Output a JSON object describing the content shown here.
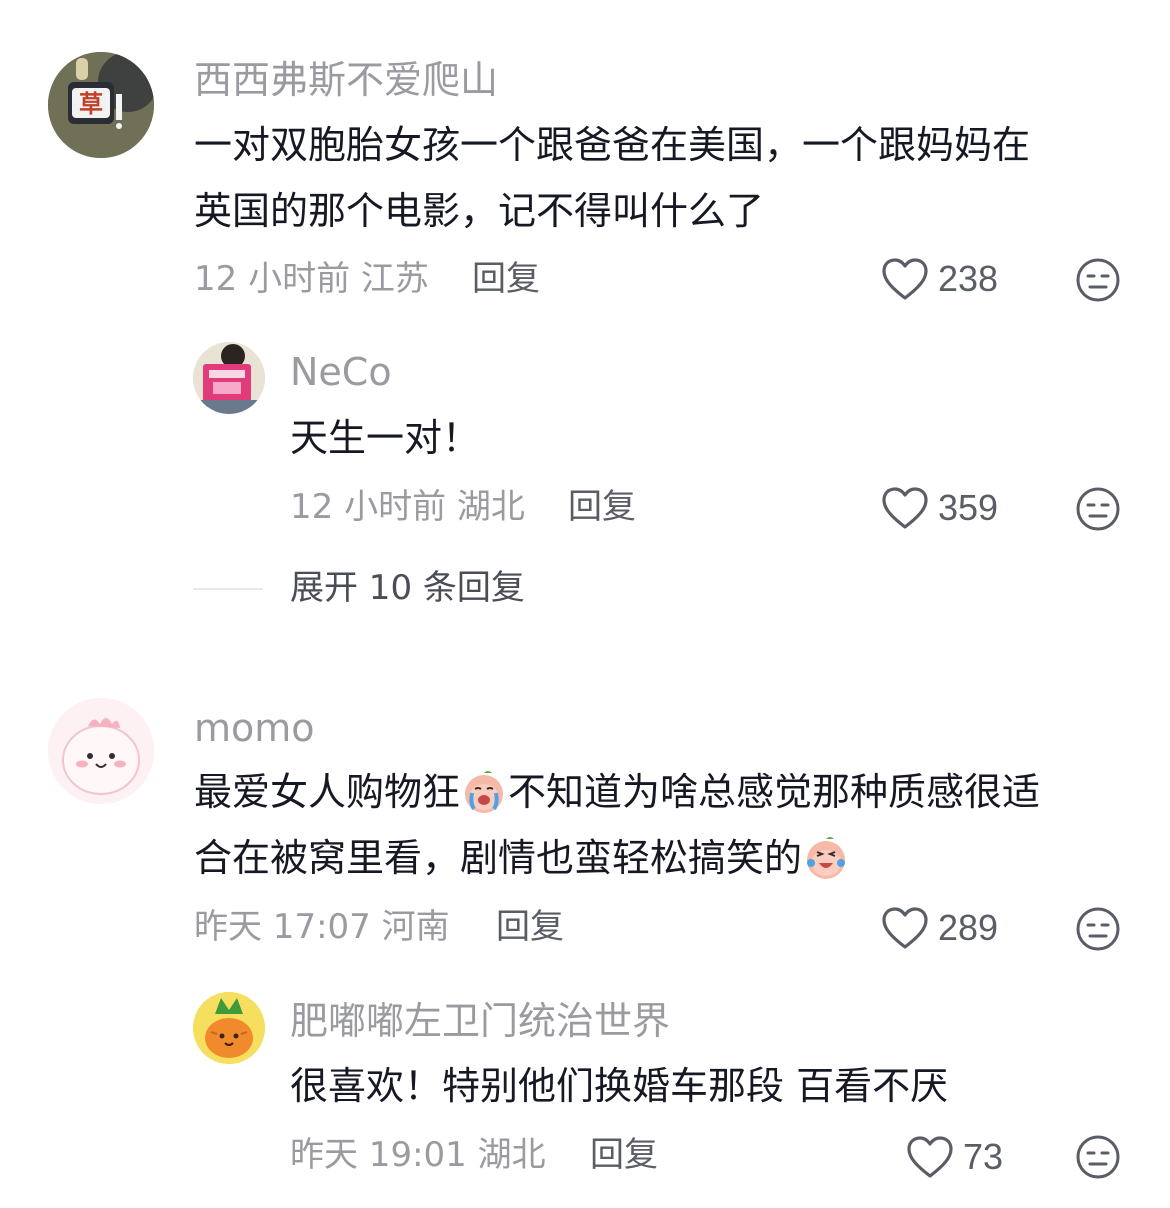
{
  "comments": [
    {
      "username": "西西弗斯不爱爬山",
      "text_line1": "一对双胞胎女孩一个跟爸爸在美国，一个跟妈妈在",
      "text_line2": "英国的那个电影，记不得叫什么了",
      "time_location": "12 小时前 江苏",
      "reply_label": "回复",
      "likes": "238",
      "avatar_icon": "avatar-grass-keychain",
      "replies": [
        {
          "username": "NeCo",
          "text": "天生一对！",
          "time_location": "12 小时前 湖北",
          "reply_label": "回复",
          "likes": "359",
          "avatar_icon": "avatar-reading-book"
        }
      ],
      "expand_label": "展开 10 条回复"
    },
    {
      "username": "momo",
      "text_line1_a": "最爱女人购物狂",
      "text_line1_b": "不知道为啥总感觉那种质感很适",
      "text_line2": "合在被窝里看，剧情也蛮轻松搞笑的",
      "emoji_1": "crying-peach-emoji",
      "emoji_2": "laughing-crying-peach-emoji",
      "time_location": "昨天 17:07 河南",
      "reply_label": "回复",
      "likes": "289",
      "avatar_icon": "avatar-pink-blob",
      "replies": [
        {
          "username": "肥嘟嘟左卫门统治世界",
          "text": "很喜欢！特别他们换婚车那段 百看不厌",
          "time_location": "昨天 19:01 湖北",
          "reply_label": "回复",
          "likes": "73",
          "avatar_icon": "avatar-carrot-character"
        }
      ]
    }
  ],
  "colors": {
    "primary_text": "#161823",
    "secondary_text": "#9a9ba0",
    "action_text": "#5b5d66",
    "background": "#ffffff"
  }
}
